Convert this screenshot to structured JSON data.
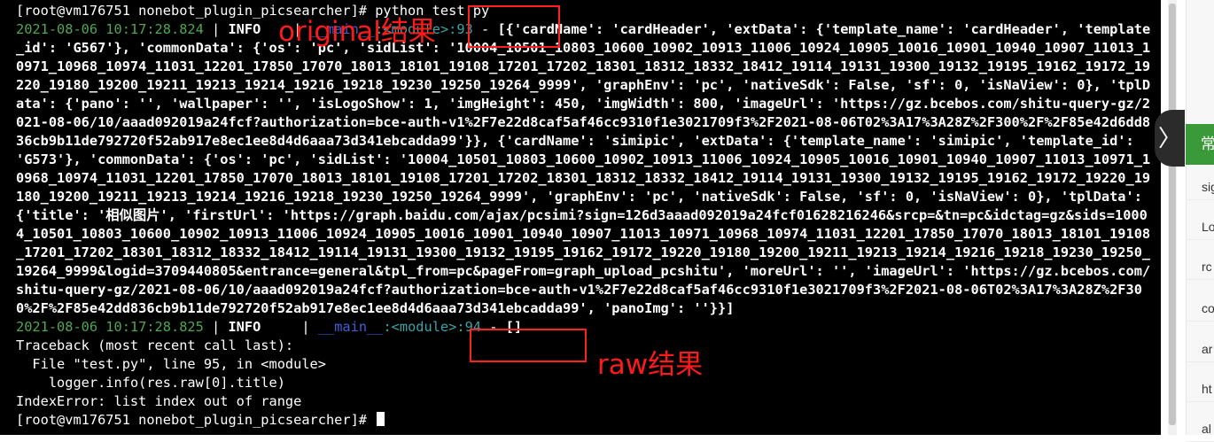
{
  "terminal": {
    "prompt_line": "[root@vm176751 nonebot_plugin_picsearcher]# python test.py",
    "log1": {
      "timestamp": "2021-08-06 10:17:28.824",
      "sep": " | ",
      "level": "INFO",
      "bar": "    | ",
      "module": "__main__",
      "module_fn": ":<module>",
      "line_no": ":93",
      "dash": " - ",
      "message": "[{'cardName': 'cardHeader', 'extData': {'template_name': 'cardHeader', 'template_id': 'G567'}, 'commonData': {'os': 'pc', 'sidList': '10004_10501_10803_10600_10902_10913_11006_10924_10905_10016_10901_10940_10907_11013_10971_10968_10974_11031_12201_17850_17070_18013_18101_19108_17201_17202_18301_18312_18332_18412_19114_19131_19300_19132_19195_19162_19172_19220_19180_19200_19211_19213_19214_19216_19218_19230_19250_19264_9999', 'graphEnv': 'pc', 'nativeSdk': False, 'sf': 0, 'isNaView': 0}, 'tplData': {'pano': '', 'wallpaper': '', 'isLogoShow': 1, 'imgHeight': 450, 'imgWidth': 800, 'imageUrl': 'https://gz.bcebos.com/shitu-query-gz/2021-08-06/10/aaad092019a24fcf?authorization=bce-auth-v1%2F7e22d8caf5af46cc9310f1e3021709f3%2F2021-08-06T02%3A17%3A28Z%2F300%2F%2F85e42d6dd836cb9b11de792720f52ab917e8ec1ee8d4d6aaa73d341ebcadda99'}}, {'cardName': 'simipic', 'extData': {'template_name': 'simipic', 'template_id': 'G573'}, 'commonData': {'os': 'pc', 'sidList': '10004_10501_10803_10600_10902_10913_11006_10924_10905_10016_10901_10940_10907_11013_10971_10968_10974_11031_12201_17850_17070_18013_18101_19108_17201_17202_18301_18312_18332_18412_19114_19131_19300_19132_19195_19162_19172_19220_19180_19200_19211_19213_19214_19216_19218_19230_19250_19264_9999', 'graphEnv': 'pc', 'nativeSdk': False, 'sf': 0, 'isNaView': 0}, 'tplData': {'title': '相似图片', 'firstUrl': 'https://graph.baidu.com/ajax/pcsimi?sign=126d3aaad092019a24fcf01628216246&srcp=&tn=pc&idctag=gz&sids=10004_10501_10803_10600_10902_10913_11006_10924_10905_10016_10901_10940_10907_11013_10971_10968_10974_11031_12201_17850_17070_18013_18101_19108_17201_17202_18301_18312_18332_18412_19114_19131_19300_19132_19195_19162_19172_19220_19180_19200_19211_19213_19214_19216_19218_19230_19250_19264_9999&logid=3709440805&entrance=general&tpl_from=pc&pageFrom=graph_upload_pcshitu', 'moreUrl': '', 'imageUrl': 'https://gz.bcebos.com/shitu-query-gz/2021-08-06/10/aaad092019a24fcf?authorization=bce-auth-v1%2F7e22d8caf5af46cc9310f1e3021709f3%2F2021-08-06T02%3A17%3A28Z%2F300%2F%2F85e42dd836cb9b11de792720f52ab917e8ec1ee8d4d6aaa73d341ebcadda99', 'panoImg': ''}}]"
    },
    "log2": {
      "timestamp": "2021-08-06 10:17:28.825",
      "sep": " | ",
      "level": "INFO",
      "bar": "     | ",
      "module": "__main__",
      "module_fn": ":<module>",
      "line_no": ":94",
      "dash": " - ",
      "message": "[]"
    },
    "traceback": [
      "Traceback (most recent call last):",
      "  File \"test.py\", line 95, in <module>",
      "    logger.info(res.raw[0].title)",
      "IndexError: list index out of range"
    ],
    "last_prompt": "[root@vm176751 nonebot_plugin_picsearcher]# "
  },
  "annotations": {
    "original_label": "original结果",
    "raw_label": "raw结果",
    "color": "#ff1a1a"
  },
  "sidebar": {
    "expand_glyph": "〉",
    "header": "常",
    "items": [
      "sig",
      "Lo",
      "rc",
      "co",
      "ar",
      "ht",
      "al"
    ]
  }
}
